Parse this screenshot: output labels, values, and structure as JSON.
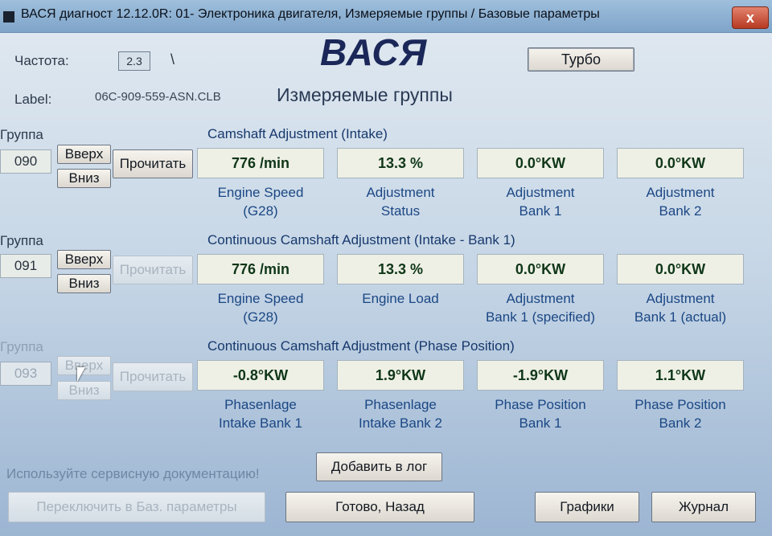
{
  "window": {
    "title": "ВАСЯ диагност 12.12.0R: 01- Электроника двигателя,  Измеряемые группы / Базовые параметры",
    "close_label": "x"
  },
  "header": {
    "freq_label": "Частота:",
    "freq_value": "2.3",
    "freq_spinner": "\\",
    "label_label": "Label:",
    "label_value": "06C-909-559-ASN.CLB",
    "brand": "ВАСЯ",
    "subtitle": "Измеряемые группы",
    "turbo_label": "Турбо"
  },
  "groups": [
    {
      "label": "Группа",
      "number": "090",
      "up": "Вверх",
      "down": "Вниз",
      "read": "Прочитать",
      "title": "Camshaft Adjustment (Intake)",
      "cells": [
        {
          "value": "776 /min",
          "caption1": "Engine Speed",
          "caption2": "(G28)"
        },
        {
          "value": "13.3 %",
          "caption1": "Adjustment",
          "caption2": "Status"
        },
        {
          "value": "0.0°KW",
          "caption1": "Adjustment",
          "caption2": "Bank 1"
        },
        {
          "value": "0.0°KW",
          "caption1": "Adjustment",
          "caption2": "Bank 2"
        }
      ]
    },
    {
      "label": "Группа",
      "number": "091",
      "up": "Вверх",
      "down": "Вниз",
      "read": "Прочитать",
      "title": "Continuous Camshaft Adjustment (Intake - Bank 1)",
      "cells": [
        {
          "value": "776 /min",
          "caption1": "Engine Speed",
          "caption2": "(G28)"
        },
        {
          "value": "13.3 %",
          "caption1": "Engine Load",
          "caption2": ""
        },
        {
          "value": "0.0°KW",
          "caption1": "Adjustment",
          "caption2": "Bank 1 (specified)"
        },
        {
          "value": "0.0°KW",
          "caption1": "Adjustment",
          "caption2": "Bank 1 (actual)"
        }
      ]
    },
    {
      "label": "Группа",
      "number": "093",
      "up": "Вверх",
      "down": "Вниз",
      "read": "Прочитать",
      "title": "Continuous Camshaft Adjustment (Phase Position)",
      "cells": [
        {
          "value": "-0.8°KW",
          "caption1": "Phasenlage",
          "caption2": "Intake Bank 1"
        },
        {
          "value": "1.9°KW",
          "caption1": "Phasenlage",
          "caption2": "Intake Bank 2"
        },
        {
          "value": "-1.9°KW",
          "caption1": "Phase Position",
          "caption2": "Bank 1"
        },
        {
          "value": "1.1°KW",
          "caption1": "Phase Position",
          "caption2": "Bank 2"
        }
      ]
    }
  ],
  "footer": {
    "hint": "Используйте сервисную документацию!",
    "add_log": "Добавить в лог",
    "switch_basic": "Переключить в Баз. параметры",
    "done_back": "Готово, Назад",
    "graphs": "Графики",
    "journal": "Журнал"
  }
}
